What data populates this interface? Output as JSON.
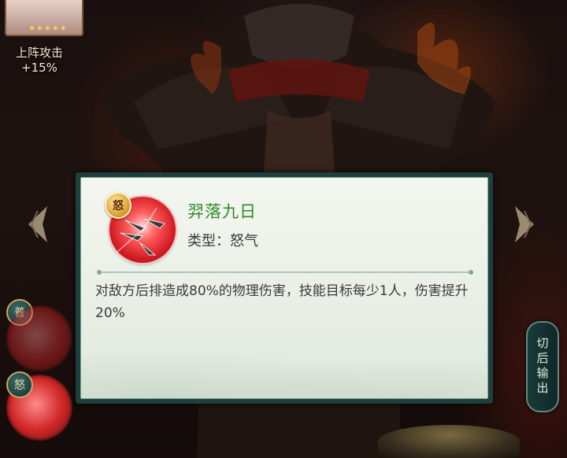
{
  "hud": {
    "attack_buff": "上阵攻击+15%",
    "stars": "★★★★★"
  },
  "side_column": {
    "top_badge": "普",
    "bottom_badge": "怒"
  },
  "switch_button": {
    "label": "切后输出"
  },
  "skill_dialog": {
    "badge": "怒",
    "name": "羿落九日",
    "type": "类型：怒气",
    "description": "对敌方后排造成80%的物理伤害，技能目标每少1人，伤害提升20%"
  },
  "colors": {
    "skill_name": "#2e8a2a",
    "dialog_frame": "#1e3f3d",
    "dialog_bg": "#f3f6ef",
    "skill_icon": "#d21c24"
  }
}
